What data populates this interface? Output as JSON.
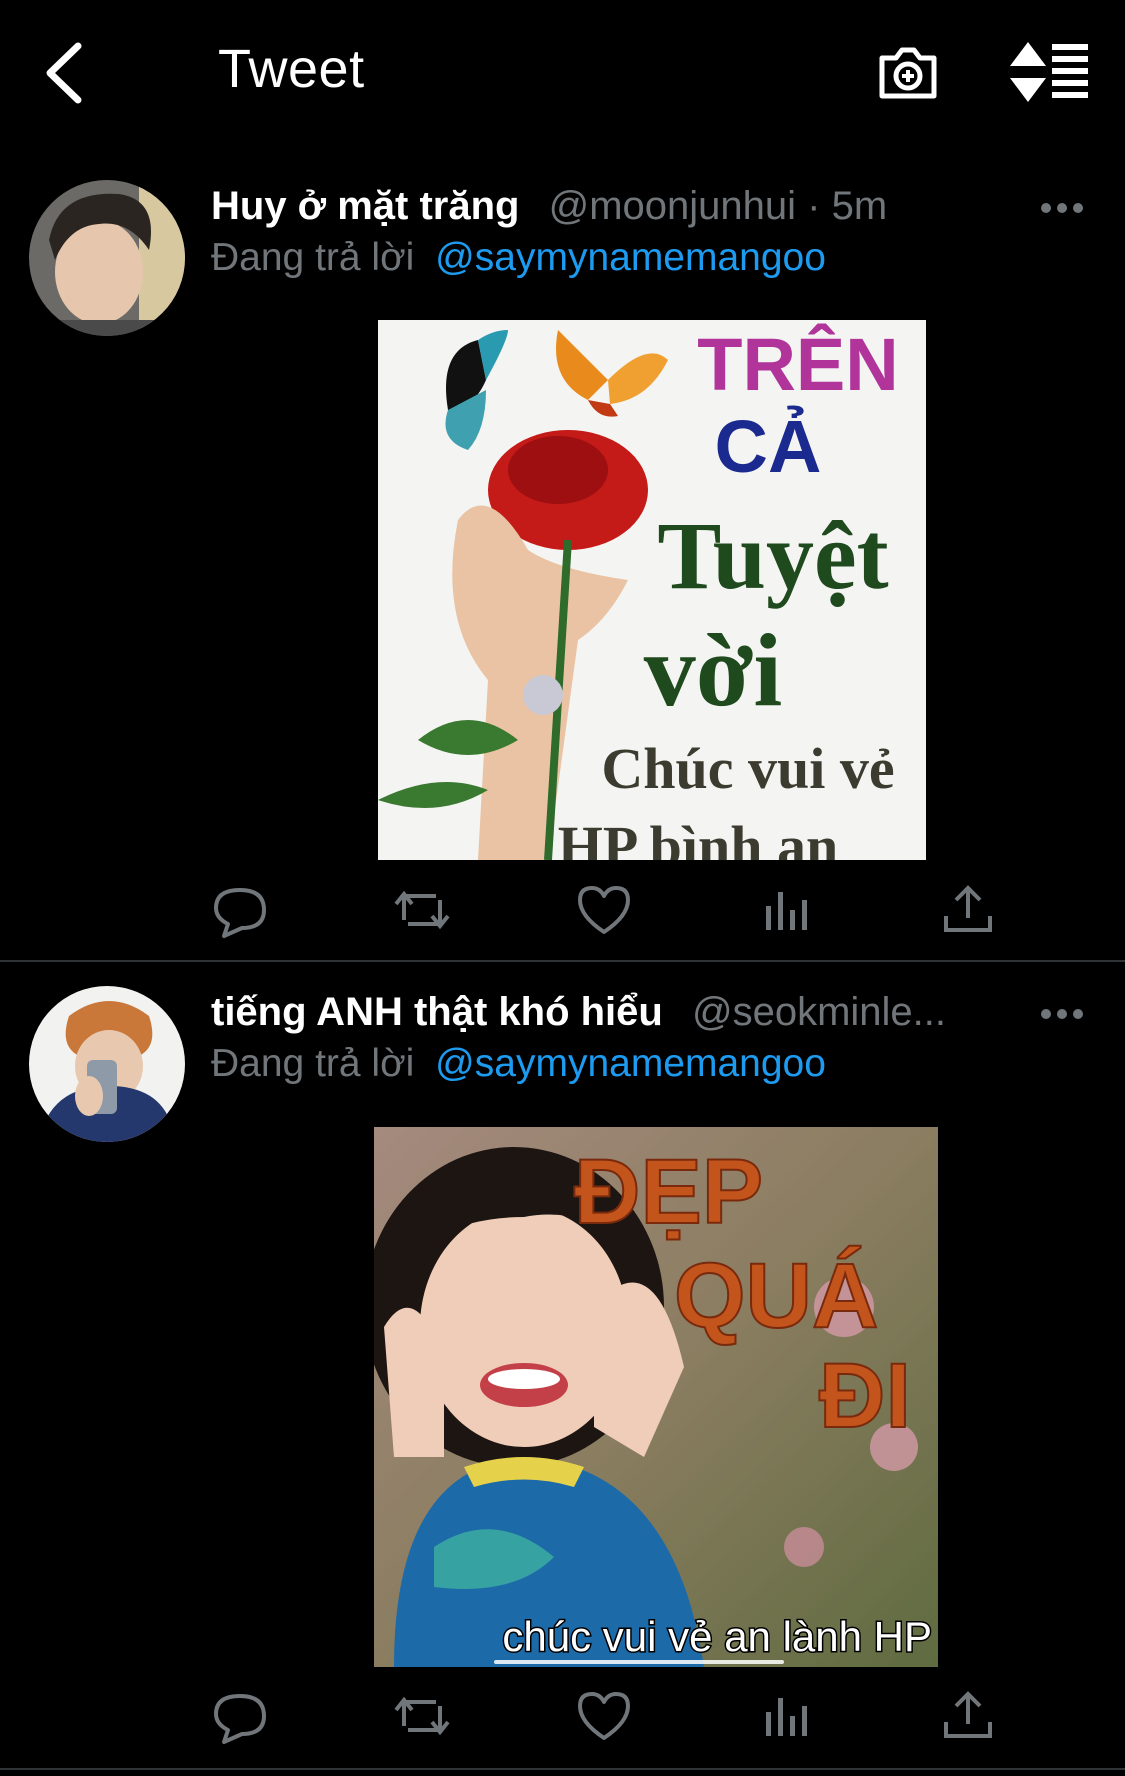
{
  "header": {
    "title": "Tweet",
    "back_icon": "chevron-left-icon",
    "camera_icon": "camera-plus-icon",
    "sort_icon": "sort-list-icon"
  },
  "colors": {
    "background": "#000000",
    "secondary_text": "#71767b",
    "link": "#1d9bf0",
    "divider": "#2f3336"
  },
  "tweets": [
    {
      "display_name": "Huy ở mặt trăng",
      "handle": "@moonjunhui · 5m",
      "reply_prefix": "Đang trả lời",
      "reply_to": "@saymynamemangoo",
      "image_text": {
        "line1": "TRÊN",
        "line2": "CẢ",
        "line3": "Tuyệt",
        "line4": "vời",
        "line5": "Chúc vui vẻ",
        "line6": "HP bình an"
      }
    },
    {
      "display_name": "tiếng ANH thật khó hiểu",
      "handle": "@seokminle...",
      "reply_prefix": "Đang trả lời",
      "reply_to": "@saymynamemangoo",
      "image_text": {
        "line1": "ĐẸP",
        "line2": "QUÁ",
        "line3": "ĐI",
        "caption": "chúc vui vẻ an lành HP"
      }
    }
  ],
  "actions": [
    "reply-icon",
    "retweet-icon",
    "like-icon",
    "analytics-icon",
    "share-icon"
  ]
}
